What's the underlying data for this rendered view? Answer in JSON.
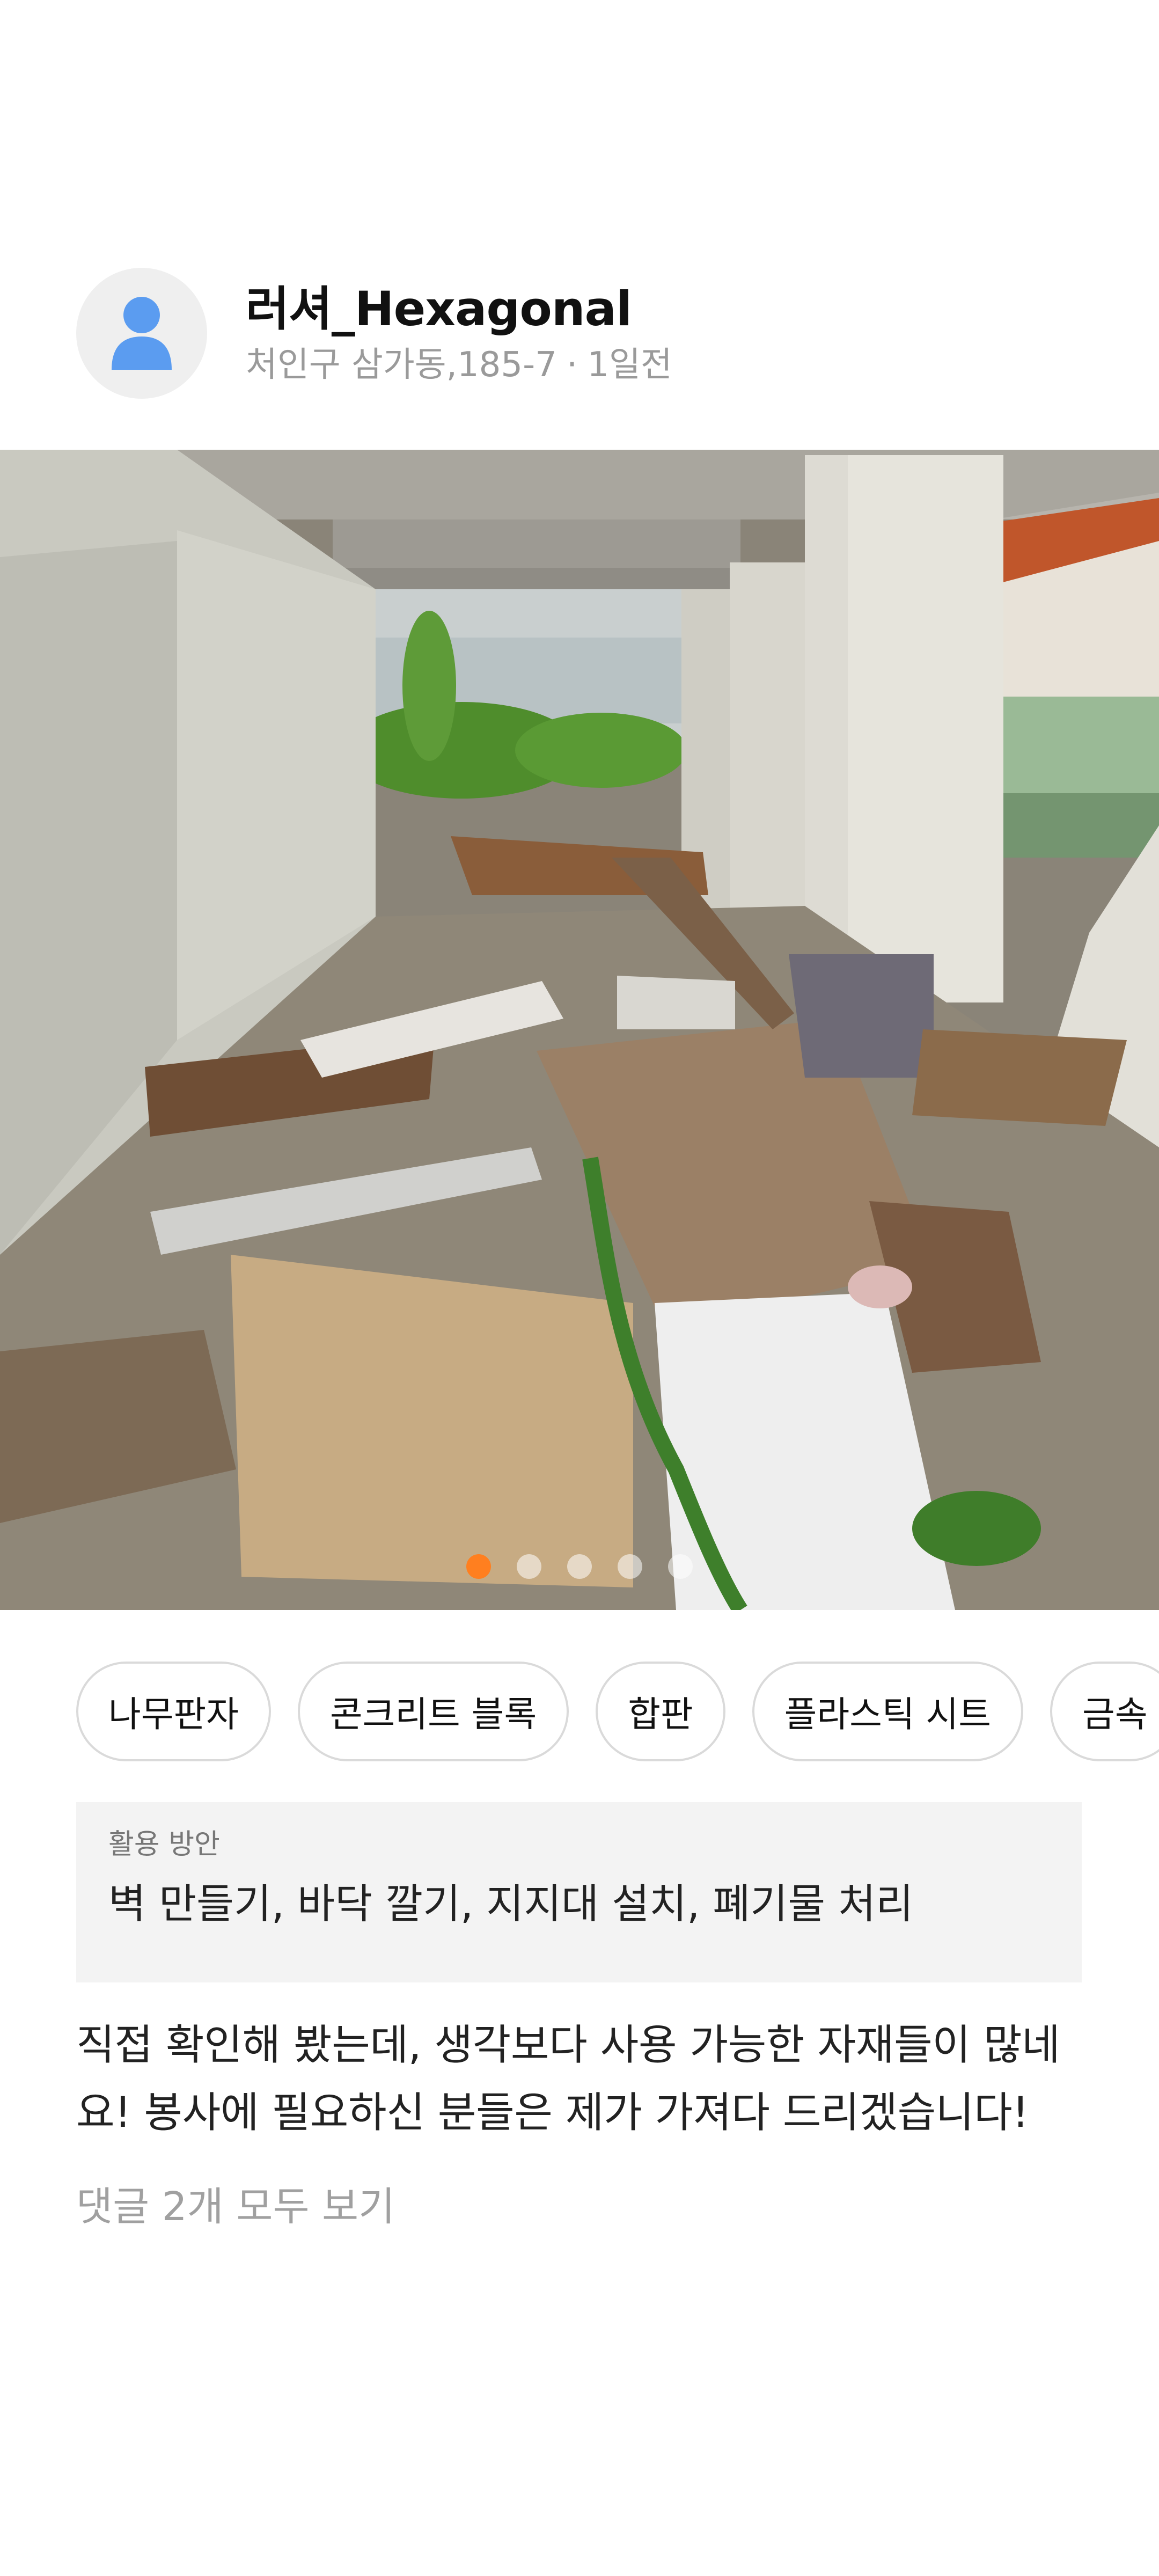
{
  "post": {
    "username": "러셔_Hexagonal",
    "location": "처인구 삼가동,185-7",
    "separator": "·",
    "time_ago": "1일전",
    "avatar_icon": "user-icon"
  },
  "photo": {
    "description_icon": "photo-image",
    "carousel": {
      "total": 5,
      "active_index": 0,
      "active_color": "#ff7f1f"
    }
  },
  "materials": [
    "나무판자",
    "콘크리트 블록",
    "합판",
    "플라스틱 시트",
    "금속"
  ],
  "usage": {
    "label": "활용 방안",
    "text": "벽 만들기, 바닥 깔기, 지지대 설치, 폐기물 처리"
  },
  "body": {
    "text": "직접 확인해 봤는데, 생각보다 사용 가능한 자재들이 많네요! 봉사에 필요하신 분들은 제가 가져다 드리겠습니다!"
  },
  "comments": {
    "link_text": "댓글 2개 모두 보기"
  }
}
